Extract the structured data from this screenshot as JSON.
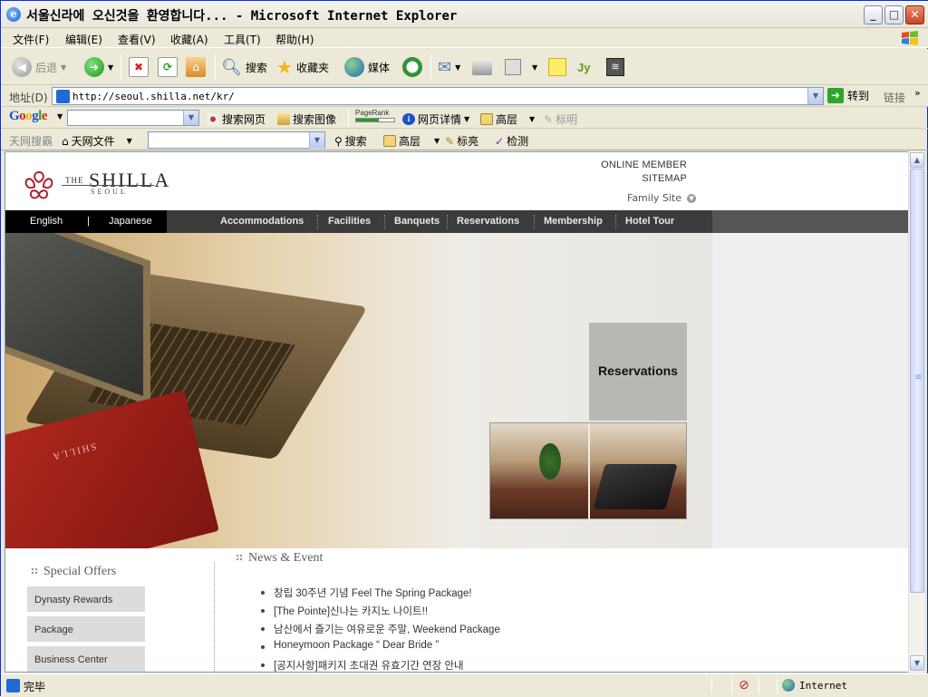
{
  "window": {
    "title": "서울신라에 오신것을 환영합니다... - Microsoft Internet Explorer",
    "icon": "ie-icon",
    "controls": [
      "minimize",
      "maximize",
      "close"
    ]
  },
  "menu": [
    "文件(F)",
    "编辑(E)",
    "查看(V)",
    "收藏(A)",
    "工具(T)",
    "帮助(H)"
  ],
  "toolbar": {
    "back": "后退",
    "search": "搜索",
    "favorites": "收藏夹",
    "media": "媒体"
  },
  "address": {
    "label": "地址(D)",
    "url": "http://seoul.shilla.net/kr/",
    "go": "转到",
    "links": "链接"
  },
  "google_bar": {
    "logo": "Google",
    "search_web": "搜索网页",
    "search_images": "搜索图像",
    "pagerank": "PageRank",
    "page_info": "网页详情",
    "up": "高层",
    "highlight": "标明"
  },
  "tianwang_bar": {
    "label": "天网搜霸",
    "files": "天网文件",
    "search": "搜索",
    "up": "高层",
    "highlight": "标亮",
    "check": "检测"
  },
  "site": {
    "logo": {
      "the": "THE",
      "name": "SHILLA",
      "city": "SEOUL"
    },
    "header_links": {
      "online_member": "ONLINE MEMBER",
      "sitemap": "SITEMAP",
      "family_site": "Family Site"
    },
    "languages": [
      "English",
      "Japanese"
    ],
    "lang_sep": "|",
    "nav": [
      "Accommodations",
      "Facilities",
      "Banquets",
      "Reservations",
      "Membership",
      "Hotel Tour"
    ],
    "hero": {
      "feature_label": "Reservations",
      "book_emboss": "SHILLA"
    },
    "special_offers": {
      "title": "Special Offers",
      "items": [
        "Dynasty Rewards",
        "Package",
        "Business Center"
      ]
    },
    "news": {
      "title": "News & Event",
      "items": [
        "창립 30주년 기념 Feel The Spring Package!",
        "[The Pointe]신나는 카지노 나이트!!",
        "남산에서 즐기는 여유로운 주말, Weekend Package",
        "Honeymoon Package “ Dear Bride ”",
        "[공지사항]패키지 초대권 유효기간 연장 안내"
      ]
    }
  },
  "status": {
    "text": "完毕",
    "zone": "Internet"
  },
  "colors": {
    "nav_bg": "#3b3b3b",
    "lang_bg": "#000000",
    "res_box": "#b9b8b5",
    "logo_red": "#a8242a"
  }
}
